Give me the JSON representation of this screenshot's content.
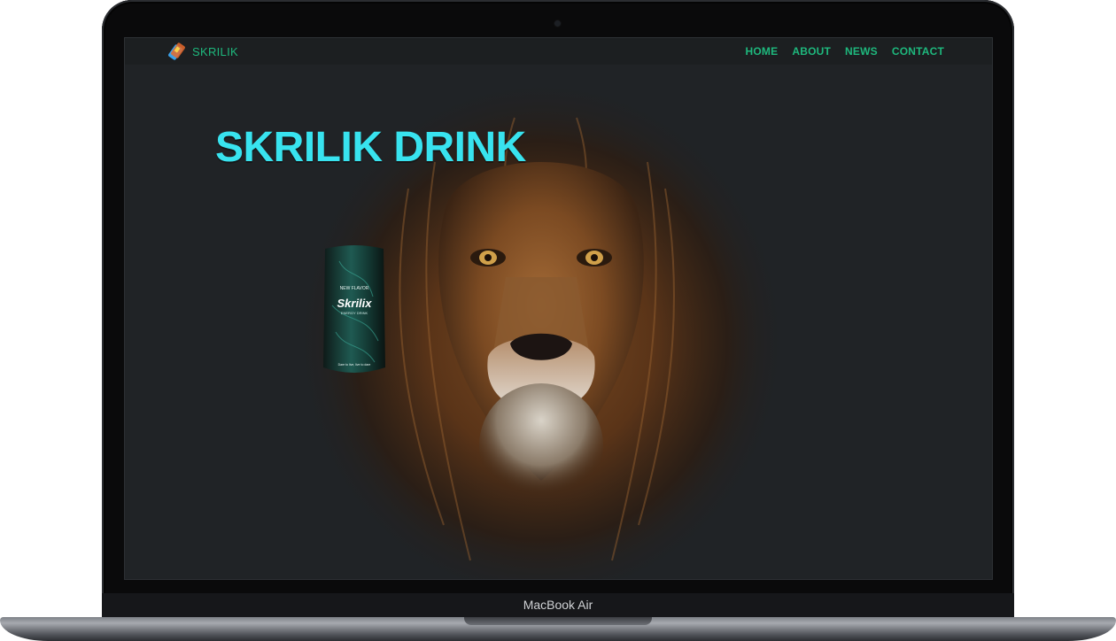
{
  "device": {
    "label": "MacBook Air"
  },
  "site": {
    "brand": "SKRILIK",
    "nav": [
      "HOME",
      "ABOUT",
      "NEWS",
      "CONTACT"
    ],
    "headline": "SKRILIK DRINK",
    "can_text": {
      "logo": "Skrilix",
      "subtitle": "ENERGY DRINK",
      "top": "NEW FLAVOR",
      "tagline": "Dare to live, live to dare"
    },
    "colors": {
      "accent": "#1eb87d",
      "headline": "#38e3ef",
      "background": "#202326",
      "navbar": "#1c1f21"
    },
    "images": {
      "hero": "lion-portrait",
      "product": "energy-drink-can"
    }
  }
}
